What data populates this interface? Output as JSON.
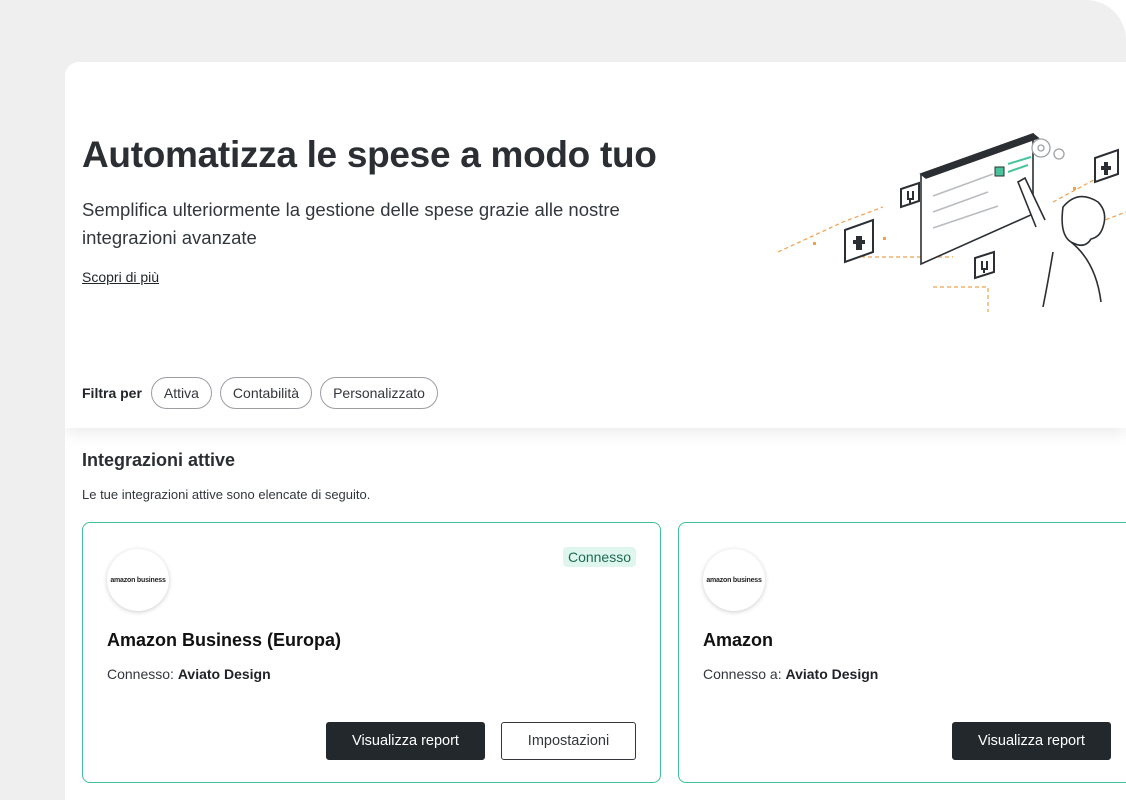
{
  "hero": {
    "title": "Automatizza le spese a modo tuo",
    "subtitle": "Semplifica ulteriormente la gestione delle spese grazie alle nostre integrazioni avanzate",
    "link": "Scopri di più"
  },
  "filters": {
    "label": "Filtra per",
    "chips": [
      "Attiva",
      "Contabilità",
      "Personalizzato"
    ]
  },
  "section": {
    "title": "Integrazioni attive",
    "description": "Le tue integrazioni attive sono elencate di seguito."
  },
  "cards": [
    {
      "logo": "amazon business",
      "badge": "Connesso",
      "title": "Amazon Business (Europa)",
      "meta_label": "Connesso:",
      "meta_value": "Aviato Design",
      "primary_button": "Visualizza report",
      "secondary_button": "Impostazioni"
    },
    {
      "logo": "amazon business",
      "title": "Amazon",
      "meta_label": "Connesso a:",
      "meta_value": "Aviato Design",
      "primary_button": "Visualizza report"
    }
  ],
  "colors": {
    "accent_border": "#3fc09b",
    "badge_bg": "#dff6ee",
    "dark_button": "#23282d",
    "illustration_accent": "#f0a04b"
  },
  "icons": [
    "puzzle-icon",
    "plug-icon",
    "gear-icon"
  ]
}
